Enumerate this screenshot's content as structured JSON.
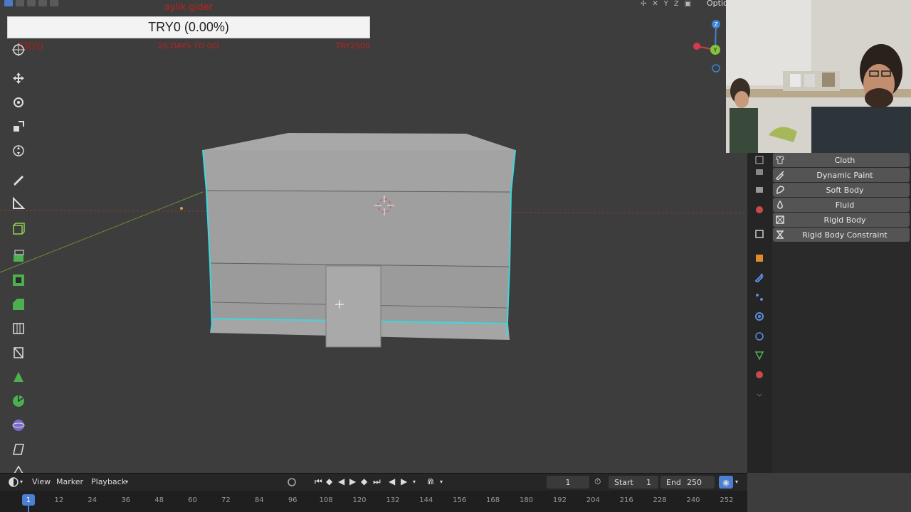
{
  "overlay": {
    "title": "aylık gider",
    "progress_label": "TRY0 (0.00%)",
    "progress_percent": 0,
    "left_label": "TRY0",
    "days_label": "26 DAYS TO GO",
    "goal_label": "TRY2500"
  },
  "header": {
    "option_label": "Option"
  },
  "gizmo": {
    "z_label": "Z",
    "y_label": "Y",
    "x_color": "#d43b4b",
    "y_color": "#86c33b",
    "z_color": "#3b82d4"
  },
  "toolbar": {
    "tools": [
      "cursor-icon",
      "move-icon",
      "rotate-icon",
      "scale-icon",
      "transform-icon",
      "annotate-icon",
      "measure-icon",
      "add-cube-icon",
      "extrude-icon",
      "inset-icon",
      "bevel-icon",
      "loop-cut-icon",
      "knife-icon",
      "poly-build-icon",
      "spin-icon",
      "smooth-icon",
      "shear-icon",
      "rip-icon"
    ]
  },
  "physics": {
    "items": [
      {
        "label": "Cloth",
        "icon": "cloth-icon"
      },
      {
        "label": "Dynamic Paint",
        "icon": "brush-icon"
      },
      {
        "label": "Soft Body",
        "icon": "soft-body-icon"
      },
      {
        "label": "Fluid",
        "icon": "drop-icon"
      },
      {
        "label": "Rigid Body",
        "icon": "rigid-body-icon"
      },
      {
        "label": "Rigid Body Constraint",
        "icon": "constraint-icon"
      }
    ]
  },
  "timeline": {
    "view_label": "View",
    "marker_label": "Marker",
    "playback_label": "Playback",
    "current_frame": "1",
    "start_label": "Start",
    "start_value": "1",
    "end_label": "End",
    "end_value": "250",
    "cursor_frame": "1",
    "ticks": [
      "12",
      "24",
      "36",
      "48",
      "60",
      "72",
      "84",
      "96",
      "108",
      "120",
      "132",
      "144",
      "156",
      "168",
      "180",
      "192",
      "204",
      "216",
      "228",
      "240",
      "252"
    ]
  },
  "colors": {
    "viewport_bg": "#3d3d3d",
    "selection_edge": "#3fd6dc",
    "accent": "#4b7fd1"
  }
}
